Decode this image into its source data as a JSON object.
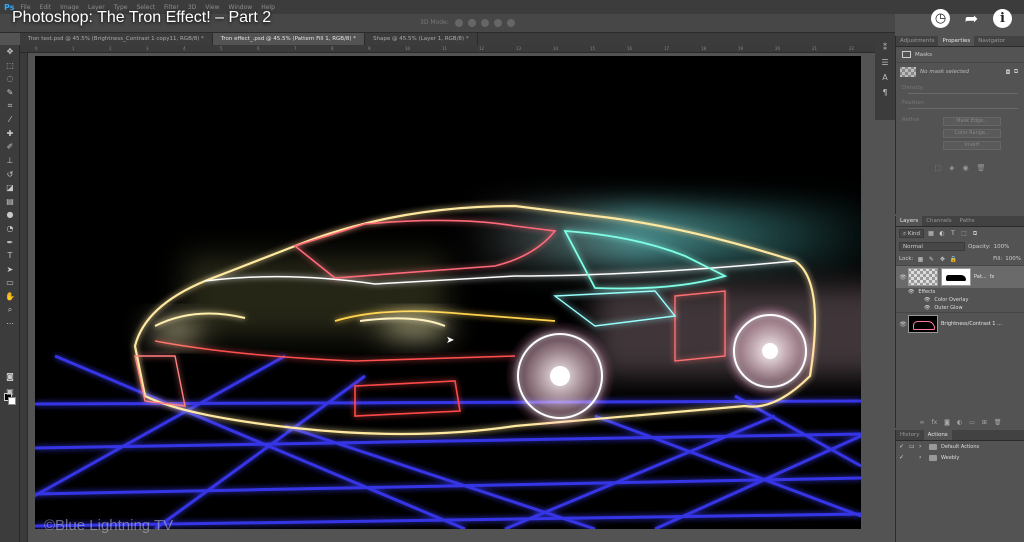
{
  "video": {
    "title": "Photoshop: The Tron Effect! – Part 2",
    "icons": [
      "clock-icon",
      "share-icon",
      "info-icon"
    ]
  },
  "menu": {
    "logo": "Ps",
    "items": [
      "File",
      "Edit",
      "Image",
      "Layer",
      "Type",
      "Select",
      "Filter",
      "3D",
      "View",
      "Window",
      "Help"
    ]
  },
  "options": {
    "mode_label": "3D Mode:"
  },
  "tabs": [
    {
      "label": "Tron test.psd @ 45.5% (Brightness_Contrast 1 copy11, RGB/8) *",
      "active": false
    },
    {
      "label": "Tron effect_.psd @ 45.5% (Pattern Fill 1, RGB/8) *",
      "active": true
    },
    {
      "label": "Shape @ 45.5% (Layer 1, RGB/8) *",
      "active": false
    }
  ],
  "ruler_marks": [
    "0",
    "1",
    "2",
    "3",
    "4",
    "5",
    "6",
    "7",
    "8",
    "9",
    "10",
    "11",
    "12",
    "13",
    "14",
    "15",
    "16",
    "17",
    "18",
    "19",
    "20",
    "21",
    "22"
  ],
  "properties": {
    "tabs": [
      "Adjustments",
      "Properties",
      "Navigator"
    ],
    "active_tab": "Properties",
    "section": "Masks",
    "no_mask": "No mask selected",
    "density_label": "Density:",
    "feather_label": "Feather:",
    "refine_label": "Refine:",
    "buttons": [
      "Mask Edge...",
      "Color Range...",
      "Invert"
    ]
  },
  "layers": {
    "tabs": [
      "Layers",
      "Channels",
      "Paths"
    ],
    "active_tab": "Layers",
    "kind": "Kind",
    "blend_mode": "Normal",
    "opacity_label": "Opacity:",
    "opacity": "100%",
    "lock_label": "Lock:",
    "fill_label": "Fill:",
    "fill": "100%",
    "items": [
      {
        "name": "Pat...",
        "fx": "fx",
        "effects_label": "Effects",
        "effects": [
          "Color Overlay",
          "Outer Glow"
        ]
      },
      {
        "name": "Brightness/Contrast 1 ..."
      }
    ]
  },
  "actions": {
    "tabs": [
      "History",
      "Actions"
    ],
    "active_tab": "Actions",
    "items": [
      "Default Actions",
      "Weebly"
    ]
  },
  "watermark": "©Blue Lightning TV",
  "colors": {
    "grid": "#3b3bff",
    "accent": "#31a8ff",
    "panel": "#535353"
  }
}
